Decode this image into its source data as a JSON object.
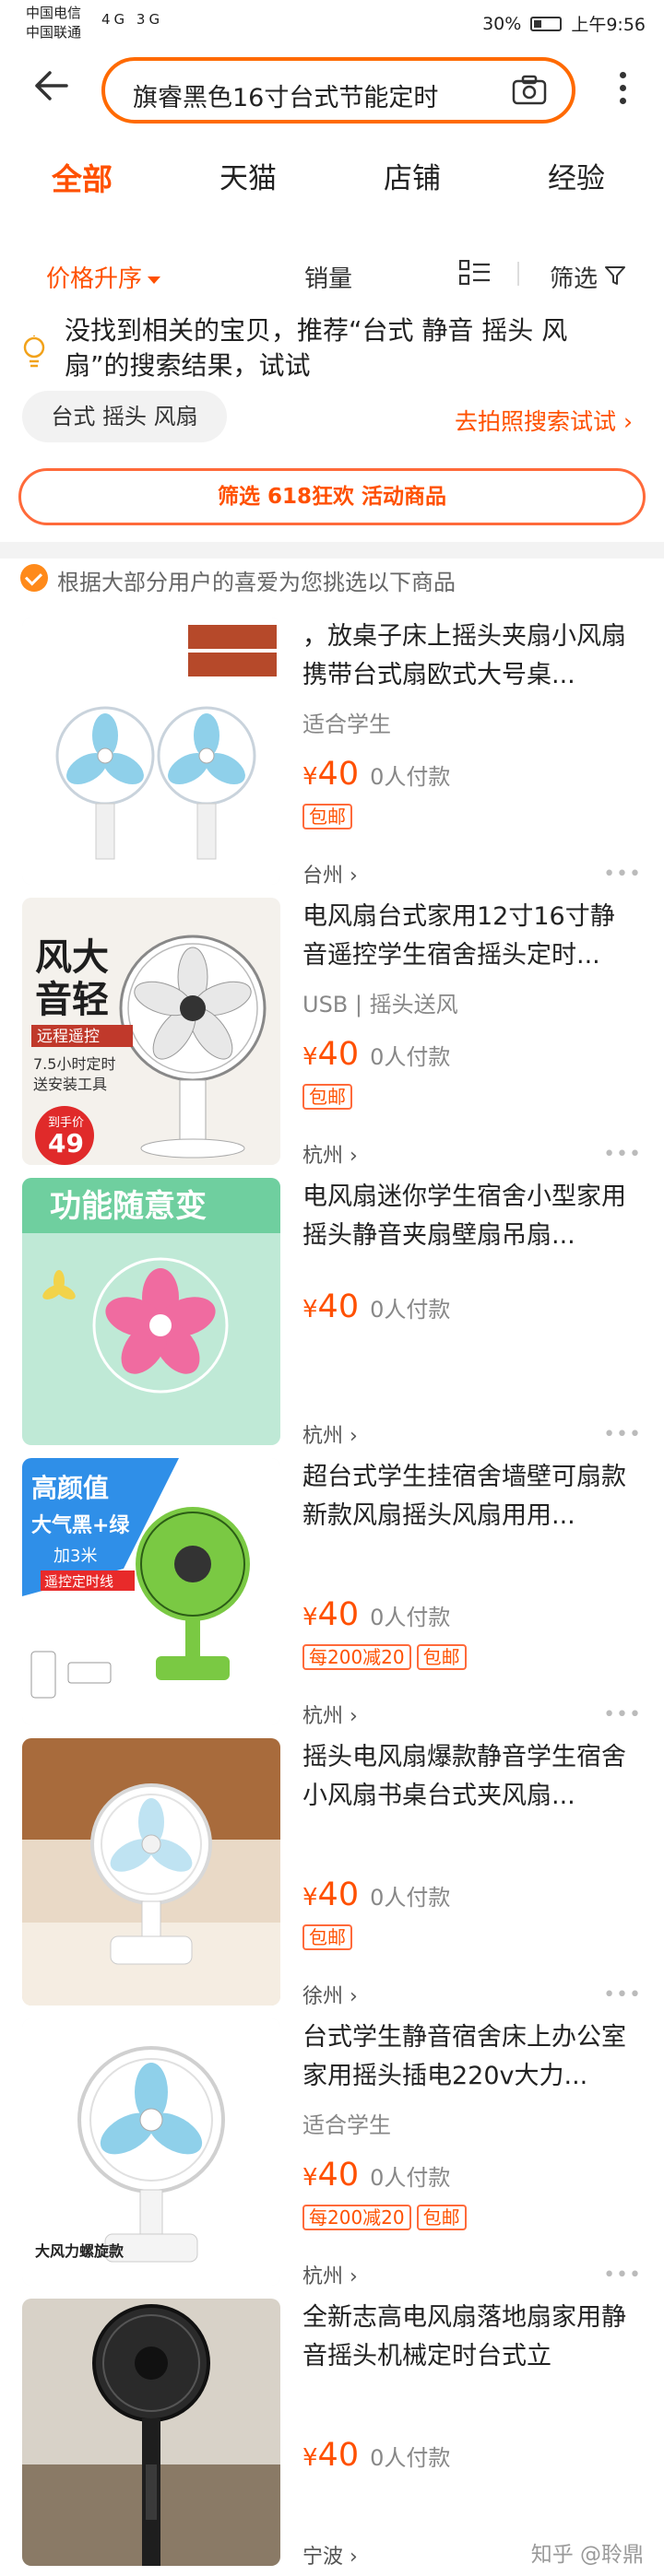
{
  "status_bar": {
    "carrier1": "中国电信",
    "carrier2": "中国联通",
    "left_signal": "4G 3G",
    "battery": "30%",
    "time": "上午9:56"
  },
  "search": {
    "back_icon": "arrow-left-icon",
    "query": "旗睿黑色16寸台式节能定时",
    "camera_icon": "camera-icon",
    "more_icon": "vertical-dots-icon"
  },
  "tabs": [
    {
      "label": "全部",
      "active": true
    },
    {
      "label": "天猫",
      "active": false
    },
    {
      "label": "店铺",
      "active": false
    },
    {
      "label": "经验",
      "active": false
    }
  ],
  "sort": {
    "price_label": "价格升序",
    "sales_label": "销量",
    "filter_label": "筛选"
  },
  "tip": {
    "text": "没找到相关的宝贝，推荐“台式 静音 摇头 风扇”的搜索结果，试试",
    "chip": "台式 摇头 风扇",
    "photo_link": "去拍照搜索试试"
  },
  "promo": {
    "label": "筛选 618狂欢 活动商品"
  },
  "notice": {
    "text": "根据大部分用户的喜爱为您挑选以下商品"
  },
  "products": [
    {
      "title": "，放桌子床上摇头夹扇小风扇携带台式扇欧式大号桌...",
      "subtitle": "适合学生",
      "currency": "¥",
      "price": "40",
      "sold": "0人付款",
      "tags": [
        "包邮"
      ],
      "location": "台州",
      "image": "clip-fan-pair"
    },
    {
      "title": "电风扇台式家用12寸16寸静音遥控学生宿舍摇头定时...",
      "subtitle": "USB | 摇头送风",
      "currency": "¥",
      "price": "40",
      "sold": "0人付款",
      "tags": [
        "包邮"
      ],
      "location": "杭州",
      "image": "pedestal-fan-ad",
      "image_text": {
        "line1": "风大",
        "line2": "音轻",
        "line3": "远程遥控",
        "line4": "7.5小时定时",
        "line5": "送安装工具",
        "badge1": "到手价",
        "badge2": "49"
      }
    },
    {
      "title": "电风扇迷你学生宿舍小型家用摇头静音夹扇壁扇吊扇...",
      "subtitle": "",
      "currency": "¥",
      "price": "40",
      "sold": "0人付款",
      "tags": [],
      "location": "杭州",
      "image": "pink-mini-fan",
      "image_text": {
        "line1": "功能随意变"
      }
    },
    {
      "title": "超台式学生挂宿舍墙壁可扇款新款风扇摇头风扇用用...",
      "subtitle": "",
      "currency": "¥",
      "price": "40",
      "sold": "0人付款",
      "tags": [
        "每200减20",
        "包邮"
      ],
      "location": "杭州",
      "image": "green-clip-fan",
      "image_text": {
        "line1": "高颜值",
        "line2": "大气黑+绿",
        "line3": "加3米",
        "line4": "遥控定时线"
      }
    },
    {
      "title": "摇头电风扇爆款静音学生宿舍小风扇书桌台式夹风扇...",
      "subtitle": "",
      "currency": "¥",
      "price": "40",
      "sold": "0人付款",
      "tags": [
        "包邮"
      ],
      "location": "徐州",
      "image": "white-clip-fan"
    },
    {
      "title": "台式学生静音宿舍床上办公室家用摇头插电220v大力...",
      "subtitle": "适合学生",
      "currency": "¥",
      "price": "40",
      "sold": "0人付款",
      "tags": [
        "每200减20",
        "包邮"
      ],
      "location": "杭州",
      "image": "white-blue-clip-fan",
      "image_text": {
        "line1": "大风力螺旋款"
      }
    },
    {
      "title": "全新志高电风扇落地扇家用静音摇头机械定时台式立",
      "subtitle": "",
      "currency": "¥",
      "price": "40",
      "sold": "0人付款",
      "tags": [],
      "location": "宁波",
      "image": "black-floor-fan"
    }
  ],
  "watermark": "知乎 @聆鼎",
  "colors": {
    "accent": "#ff5000",
    "border_orange": "#ff6a00",
    "bg_gray": "#f3f3f3"
  }
}
